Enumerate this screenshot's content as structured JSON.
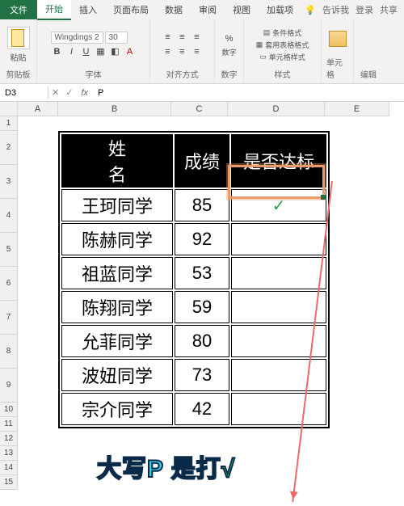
{
  "tabs": {
    "file": "文件",
    "home": "开始",
    "insert": "插入",
    "layout": "页面布局",
    "data": "数据",
    "review": "审阅",
    "view": "视图",
    "addins": "加载项",
    "tellme": "告诉我",
    "login": "登录",
    "share": "共享"
  },
  "ribbon": {
    "clipboard": "剪贴板",
    "paste": "粘贴",
    "font_group": "字体",
    "font_name": "Wingdings 2",
    "font_size": "30",
    "align_group": "对齐方式",
    "number_group": "数字",
    "number_btn": "数字",
    "styles_group": "样式",
    "cond_fmt": "条件格式",
    "table_fmt": "套用表格格式",
    "cell_styles": "单元格样式",
    "cells_group": "单元格",
    "edit_group": "编辑"
  },
  "namebox": "D3",
  "fx": "fx",
  "formula": "P",
  "cols": {
    "A": "A",
    "B": "B",
    "C": "C",
    "D": "D",
    "E": "E"
  },
  "table": {
    "h_name": "姓 名",
    "h_score": "成绩",
    "h_pass": "是否达标",
    "rows": [
      {
        "name": "王珂同学",
        "score": "85",
        "pass": "✓"
      },
      {
        "name": "陈赫同学",
        "score": "92",
        "pass": ""
      },
      {
        "name": "祖蓝同学",
        "score": "53",
        "pass": ""
      },
      {
        "name": "陈翔同学",
        "score": "59",
        "pass": ""
      },
      {
        "name": "允菲同学",
        "score": "80",
        "pass": ""
      },
      {
        "name": "波妞同学",
        "score": "73",
        "pass": ""
      },
      {
        "name": "宗介同学",
        "score": "42",
        "pass": ""
      }
    ]
  },
  "caption_a": "大写P 是打",
  "caption_b": "√"
}
